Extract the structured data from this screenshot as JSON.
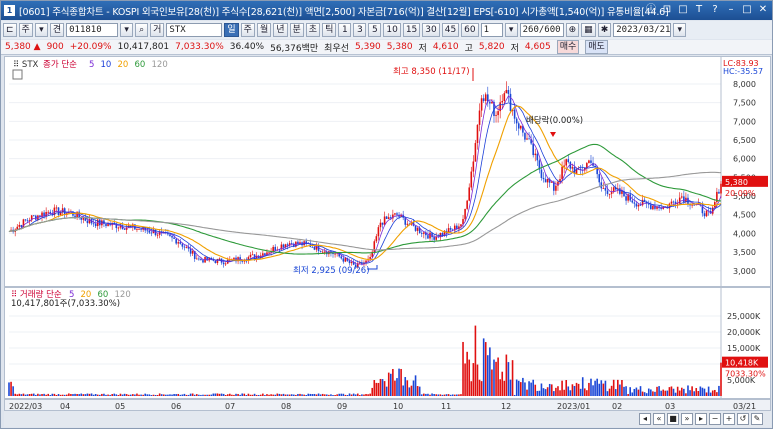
{
  "window": {
    "title": "[0601] 주식종합차트 - KOSPI 외국인보유[28(천)] 주식수[28,621(천)] 액면[2,500] 자본금[716(억)] 결산[12월] EPS[-610] 시가총액[1,540(억)] 유통비율[44.6]",
    "controls": [
      "ⓘ",
      "⊡",
      "□",
      "T",
      "?",
      "–",
      "□",
      "✕"
    ]
  },
  "toolbar": {
    "period_select": "주",
    "stock_mode": "견",
    "code": "011810",
    "market_label": "거",
    "stock_name": "STX",
    "tabs": [
      "일",
      "주",
      "월",
      "년",
      "분",
      "초",
      "틱"
    ],
    "active_tab": "일",
    "intervals": [
      "1",
      "3",
      "5",
      "10",
      "15",
      "30",
      "45",
      "60"
    ],
    "count_value": "1",
    "zoom": "260/600",
    "date": "2023/03/21",
    "buy_label": "매수",
    "sell_label": "매도"
  },
  "quote": {
    "price": "5,380 ▲",
    "change": "900",
    "change_pct": "+20.09%",
    "volume": "10,417,801",
    "vol_ratio": "7,033.30%",
    "turnover": "36.40%",
    "amount": "56,376백만",
    "best_label": "최우선",
    "best_ask": "5,390",
    "best_bid": "5,380",
    "low_label": "저",
    "low": "4,610",
    "high_label": "고",
    "high": "5,820",
    "open_label": "저",
    "open": "4,605"
  },
  "price_legend": {
    "symbol": "STX",
    "label": "종가 단순",
    "ma": [
      "5",
      "10",
      "20",
      "60",
      "120"
    ]
  },
  "vol_legend": {
    "label": "거래량 단순",
    "ma": [
      "5",
      "20",
      "60",
      "120"
    ],
    "value": "10,417,801주(7,033.30%)"
  },
  "annotations": {
    "high": "최고 8,350 (11/17)",
    "low": "최저 2,925 (09/26)",
    "dividend": "배당락(0.00%)"
  },
  "price_axis": {
    "lc": "LC:83.93",
    "hc": "HC:-35.57",
    "ticks": [
      "8,000",
      "7,500",
      "7,000",
      "6,500",
      "6,000",
      "5,500",
      "5,000",
      "4,500",
      "4,000",
      "3,500",
      "3,000"
    ],
    "current_price": "5,380",
    "current_pct": "20.09%"
  },
  "vol_axis": {
    "ticks": [
      "25,000K",
      "20,000K",
      "15,000K",
      "10,000K",
      "5,000K"
    ],
    "current_vol": "10,418K",
    "current_pct": "7033.30%"
  },
  "x_axis": {
    "labels": [
      "2022/03",
      "04",
      "05",
      "06",
      "07",
      "08",
      "09",
      "10",
      "11",
      "12",
      "2023/01",
      "02",
      "03"
    ],
    "end_date": "03/21"
  },
  "colors": {
    "up": "#e01010",
    "down": "#1a46d6",
    "ma5": "#7a2ad6",
    "ma10": "#1b3fd8",
    "ma20": "#f0a000",
    "ma60": "#2e9a3a",
    "ma120": "#999999"
  },
  "chart_data": {
    "type": "candlestick",
    "title": "STX",
    "ylim": [
      2700,
      8400
    ],
    "series": [
      {
        "name": "종가",
        "x": [
          "2022/03",
          "04",
          "05",
          "06",
          "07",
          "08",
          "09",
          "10",
          "11",
          "12",
          "2023/01",
          "02",
          "03"
        ],
        "values": [
          4050,
          4550,
          4250,
          4050,
          3400,
          3300,
          3700,
          3200,
          4000,
          7400,
          5400,
          5600,
          5380
        ]
      },
      {
        "name": "거래량",
        "values": [
          3000,
          500,
          400,
          300,
          300,
          800,
          900,
          18000,
          22000,
          12000,
          8000,
          6000,
          10418
        ]
      }
    ],
    "annotations": [
      "최고 8,350 (11/17)",
      "최저 2,925 (09/26)",
      "배당락(0.00%)"
    ]
  }
}
